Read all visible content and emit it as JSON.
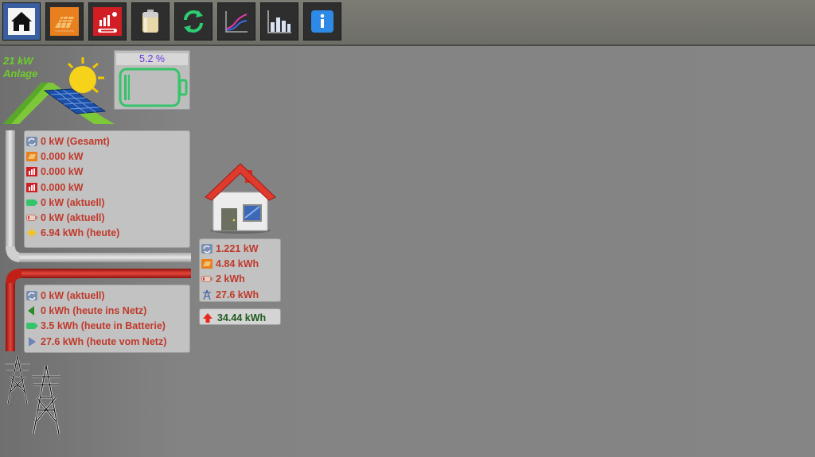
{
  "toolbar": {
    "buttons": [
      {
        "name": "home-button",
        "icon": "home-icon"
      },
      {
        "name": "solar-button",
        "icon": "solar-panel-icon"
      },
      {
        "name": "inverter-button",
        "icon": "inverter-icon"
      },
      {
        "name": "battery-button",
        "icon": "battery-icon"
      },
      {
        "name": "refresh-button",
        "icon": "refresh-icon"
      },
      {
        "name": "chart-line-button",
        "icon": "line-chart-icon"
      },
      {
        "name": "chart-bar-button",
        "icon": "bar-chart-icon"
      },
      {
        "name": "info-button",
        "icon": "info-icon"
      }
    ]
  },
  "plant": {
    "power": "21 kW",
    "label": "Anlage"
  },
  "battery": {
    "percent_label": "5.2 %",
    "level": 0.052,
    "color": "#35c46a"
  },
  "production_panel": {
    "rows": [
      {
        "icon": "refresh-icon",
        "text": "0 kW (Gesamt)"
      },
      {
        "icon": "solar-panel-icon",
        "text": "0.000 kW"
      },
      {
        "icon": "inverter-icon",
        "text": "0.000 kW"
      },
      {
        "icon": "inverter-icon",
        "text": "0.000 kW"
      },
      {
        "icon": "battery-charge-icon",
        "text": "0 kW (aktuell)"
      },
      {
        "icon": "battery-discharge-icon",
        "text": "0 kW (aktuell)"
      },
      {
        "icon": "sun-icon",
        "text": "6.94 kWh (heute)"
      }
    ]
  },
  "grid_panel": {
    "rows": [
      {
        "icon": "refresh-icon",
        "text": "0 kW (aktuell)"
      },
      {
        "icon": "arrow-left-icon",
        "text": "0 kWh (heute ins Netz)"
      },
      {
        "icon": "battery-charge-icon",
        "text": "3.5 kWh (heute in Batterie)"
      },
      {
        "icon": "arrow-right-icon",
        "text": "27.6 kWh (heute vom Netz)"
      }
    ]
  },
  "house_panel": {
    "rows": [
      {
        "icon": "refresh-icon",
        "text": "1.221 kW"
      },
      {
        "icon": "solar-panel-icon",
        "text": "4.84 kWh"
      },
      {
        "icon": "battery-discharge-icon",
        "text": "2 kWh"
      },
      {
        "icon": "power-tower-icon",
        "text": "27.6 kWh"
      }
    ]
  },
  "total": {
    "icon": "arrow-up-icon",
    "text": "34.44 kWh"
  },
  "colors": {
    "accent_red": "#c0392b",
    "plant_green": "#6ecf2a",
    "pipe_red": "#c02018",
    "total_green": "#1e5a1e"
  }
}
